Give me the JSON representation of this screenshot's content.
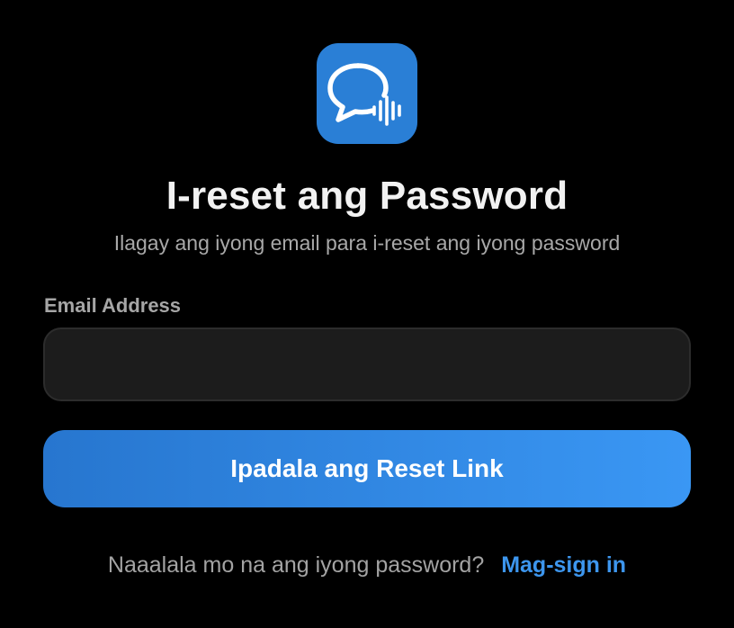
{
  "logo": {
    "icon": "chat-bubble-soundwave-icon",
    "background_color": "#2a7fd6"
  },
  "header": {
    "title": "I-reset ang Password",
    "subtitle": "Ilagay ang iyong email para i-reset ang iyong password"
  },
  "form": {
    "email_label": "Email Address",
    "email_value": "",
    "email_placeholder": "",
    "submit_label": "Ipadala ang Reset Link"
  },
  "footer": {
    "prompt": "Naaalala mo na ang iyong password?",
    "signin_link": "Mag-sign in"
  },
  "colors": {
    "background": "#000000",
    "accent": "#3d96ee",
    "button_gradient_start": "#2776cf",
    "button_gradient_end": "#3a97f4",
    "input_background": "#1c1c1c"
  }
}
